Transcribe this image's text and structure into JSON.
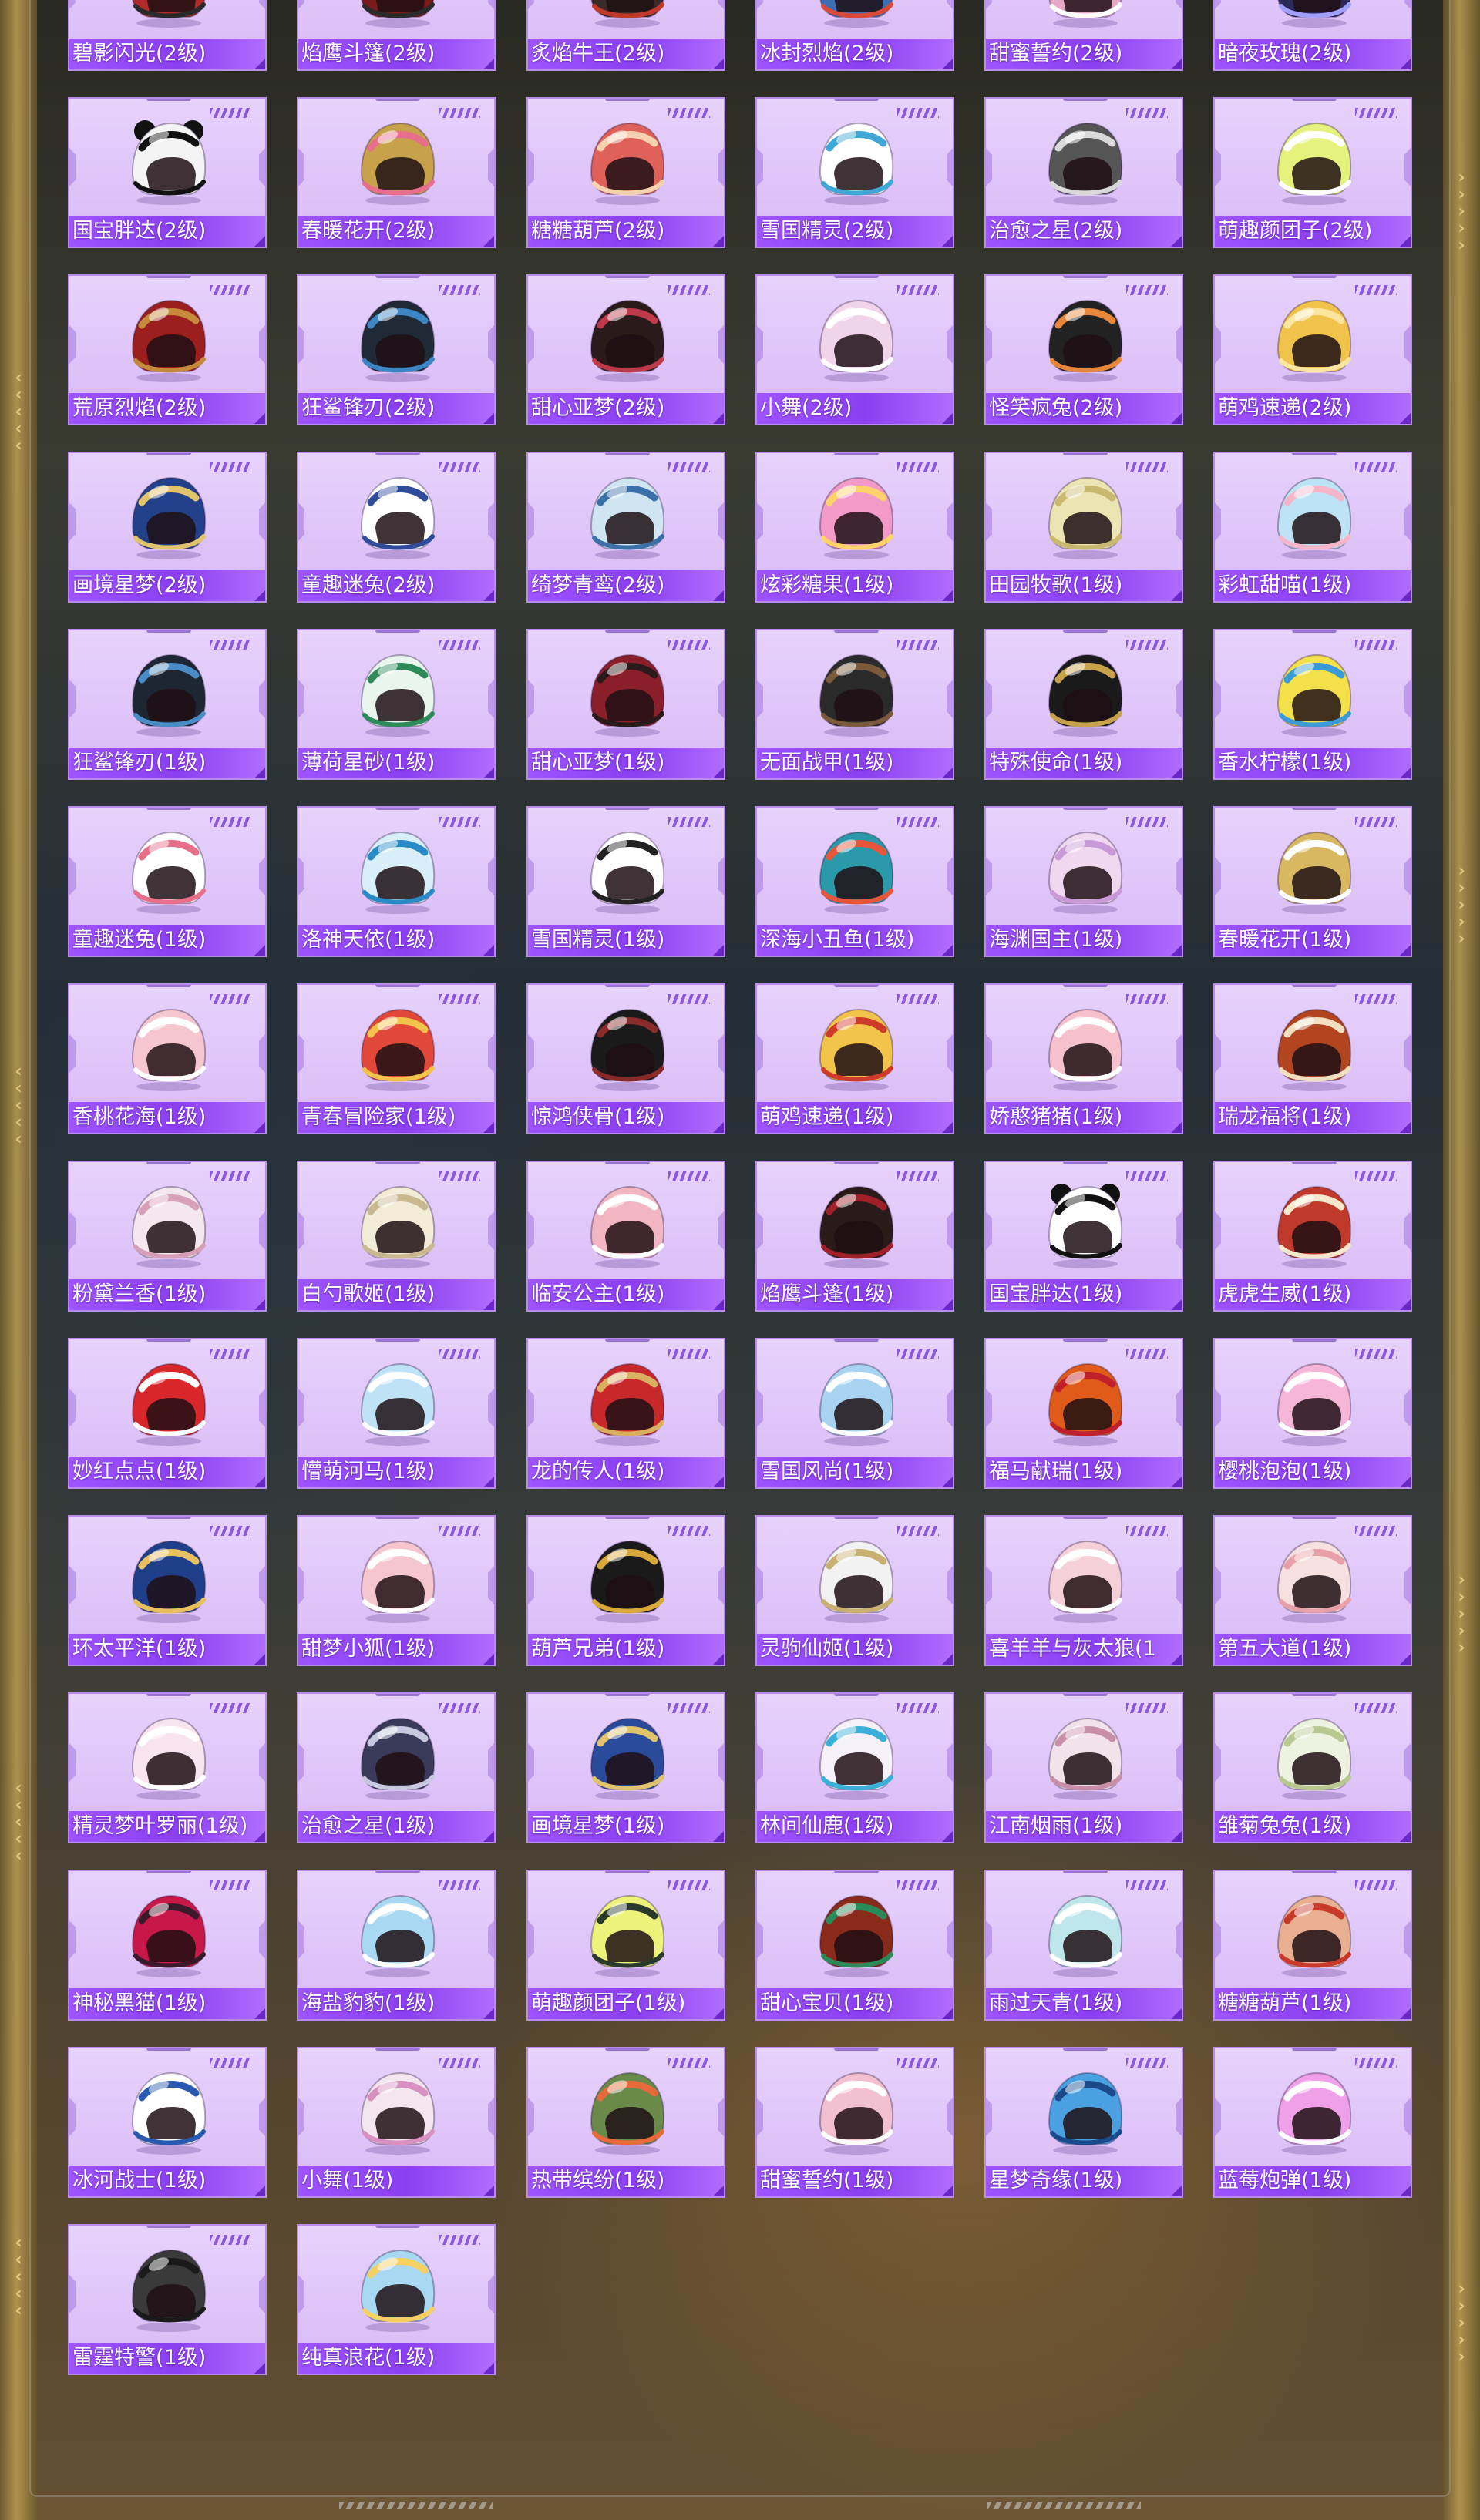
{
  "theme": {
    "card_bg": "#e1c6fa",
    "label_bg": "#9147f5",
    "accent": "#8c58e0",
    "frame_gold": "#b89a52"
  },
  "items": [
    {
      "label": "碧影闪光(2级)",
      "primary": "#b02a2a",
      "secondary": "#2a2a2a",
      "icon": "helmet-icon"
    },
    {
      "label": "焰鹰斗篷(2级)",
      "primary": "#7a1a1a",
      "secondary": "#2b2b2b",
      "icon": "helmet-icon"
    },
    {
      "label": "炙焰牛王(2级)",
      "primary": "#3a2a2a",
      "secondary": "#c0392b",
      "icon": "helmet-icon"
    },
    {
      "label": "冰封烈焰(2级)",
      "primary": "#3b6fb5",
      "secondary": "#d84a3a",
      "icon": "helmet-icon"
    },
    {
      "label": "甜蜜誓约(2级)",
      "primary": "#e7a9c6",
      "secondary": "#ffffff",
      "icon": "helmet-icon"
    },
    {
      "label": "暗夜玫瑰(2级)",
      "primary": "#2a2a5a",
      "secondary": "#a0a0ff",
      "icon": "helmet-icon"
    },
    {
      "label": "国宝胖达(2级)",
      "primary": "#f4f4f4",
      "secondary": "#111111",
      "icon": "panda-helmet-icon"
    },
    {
      "label": "春暖花开(2级)",
      "primary": "#c7a24a",
      "secondary": "#e86f8a",
      "icon": "helmet-icon"
    },
    {
      "label": "糖糖葫芦(2级)",
      "primary": "#e0615a",
      "secondary": "#f6d1b0",
      "icon": "helmet-icon"
    },
    {
      "label": "雪国精灵(2级)",
      "primary": "#ffffff",
      "secondary": "#3fa7d6",
      "icon": "helmet-icon"
    },
    {
      "label": "治愈之星(2级)",
      "primary": "#555555",
      "secondary": "#d9d9d9",
      "icon": "helmet-icon"
    },
    {
      "label": "萌趣颜团子(2级)",
      "primary": "#e5f27b",
      "secondary": "#ffffff",
      "icon": "helmet-icon"
    },
    {
      "label": "荒原烈焰(2级)",
      "primary": "#9c1f1f",
      "secondary": "#c58a3a",
      "icon": "helmet-icon"
    },
    {
      "label": "狂鲨锋刃(2级)",
      "primary": "#202a36",
      "secondary": "#3d86c6",
      "icon": "helmet-icon"
    },
    {
      "label": "甜心亚梦(2级)",
      "primary": "#2b1a1a",
      "secondary": "#c0394a",
      "icon": "helmet-icon"
    },
    {
      "label": "小舞(2级)",
      "primary": "#f1d4ea",
      "secondary": "#ffffff",
      "icon": "helmet-icon"
    },
    {
      "label": "怪笑疯兔(2级)",
      "primary": "#222222",
      "secondary": "#e8863a",
      "icon": "helmet-icon"
    },
    {
      "label": "萌鸡速递(2级)",
      "primary": "#f2c34a",
      "secondary": "#fbe6a0",
      "icon": "helmet-icon"
    },
    {
      "label": "画境星梦(2级)",
      "primary": "#23408a",
      "secondary": "#e0c36a",
      "icon": "helmet-icon"
    },
    {
      "label": "童趣迷兔(2级)",
      "primary": "#ffffff",
      "secondary": "#2f4b9a",
      "icon": "helmet-icon"
    },
    {
      "label": "绮梦青鸾(2级)",
      "primary": "#cfe6f2",
      "secondary": "#3a6fa8",
      "icon": "helmet-icon"
    },
    {
      "label": "炫彩糖果(1级)",
      "primary": "#f29ac8",
      "secondary": "#ffd36a",
      "icon": "helmet-icon"
    },
    {
      "label": "田园牧歌(1级)",
      "primary": "#ece4b2",
      "secondary": "#c9b96e",
      "icon": "helmet-icon"
    },
    {
      "label": "彩虹甜喵(1级)",
      "primary": "#bfe3f6",
      "secondary": "#f5b6c9",
      "icon": "helmet-icon"
    },
    {
      "label": "狂鲨锋刃(1级)",
      "primary": "#1d2733",
      "secondary": "#4a8cc5",
      "icon": "helmet-icon"
    },
    {
      "label": "薄荷星砂(1级)",
      "primary": "#e8f6ee",
      "secondary": "#2f8a5a",
      "icon": "helmet-icon"
    },
    {
      "label": "甜心亚梦(1级)",
      "primary": "#8a1f2a",
      "secondary": "#2a1a1a",
      "icon": "helmet-icon"
    },
    {
      "label": "无面战甲(1级)",
      "primary": "#2a2a2a",
      "secondary": "#7a5a3a",
      "icon": "helmet-icon"
    },
    {
      "label": "特殊使命(1级)",
      "primary": "#1a1a1a",
      "secondary": "#c7a24a",
      "icon": "helmet-icon"
    },
    {
      "label": "香水柠檬(1级)",
      "primary": "#f4e04a",
      "secondary": "#3a9ad6",
      "icon": "helmet-icon"
    },
    {
      "label": "童趣迷兔(1级)",
      "primary": "#ffffff",
      "secondary": "#e86f8a",
      "icon": "helmet-icon"
    },
    {
      "label": "洛神天依(1级)",
      "primary": "#d8eef8",
      "secondary": "#2a8ac6",
      "icon": "helmet-icon"
    },
    {
      "label": "雪国精灵(1级)",
      "primary": "#ffffff",
      "secondary": "#222222",
      "icon": "helmet-icon"
    },
    {
      "label": "深海小丑鱼(1级)",
      "primary": "#2a9aaa",
      "secondary": "#e8563a",
      "icon": "helmet-icon"
    },
    {
      "label": "海渊国主(1级)",
      "primary": "#f0d8f0",
      "secondary": "#c89ad8",
      "icon": "helmet-icon"
    },
    {
      "label": "春暖花开(1级)",
      "primary": "#d8b860",
      "secondary": "#ffffff",
      "icon": "helmet-icon"
    },
    {
      "label": "香桃花海(1级)",
      "primary": "#f6c6d0",
      "secondary": "#ffffff",
      "icon": "helmet-icon"
    },
    {
      "label": "青春冒险家(1级)",
      "primary": "#e2483a",
      "secondary": "#f2c34a",
      "icon": "helmet-icon"
    },
    {
      "label": "惊鸿侠骨(1级)",
      "primary": "#1a1a1a",
      "secondary": "#8a2a2a",
      "icon": "helmet-icon"
    },
    {
      "label": "萌鸡速递(1级)",
      "primary": "#f2c44a",
      "secondary": "#d03a2a",
      "icon": "helmet-icon"
    },
    {
      "label": "娇憨猪猪(1级)",
      "primary": "#f6c0cc",
      "secondary": "#ffffff",
      "icon": "helmet-icon"
    },
    {
      "label": "瑞龙福将(1级)",
      "primary": "#b2441f",
      "secondary": "#f0e0c0",
      "icon": "helmet-icon"
    },
    {
      "label": "粉黛兰香(1级)",
      "primary": "#f4e8ee",
      "secondary": "#d8a0b8",
      "icon": "helmet-icon"
    },
    {
      "label": "白勺歌姬(1级)",
      "primary": "#f2ebd6",
      "secondary": "#c9b890",
      "icon": "helmet-icon"
    },
    {
      "label": "临安公主(1级)",
      "primary": "#f2b6c2",
      "secondary": "#ffffff",
      "icon": "helmet-icon"
    },
    {
      "label": "焰鹰斗篷(1级)",
      "primary": "#2a1a1a",
      "secondary": "#a0202a",
      "icon": "helmet-icon"
    },
    {
      "label": "国宝胖达(1级)",
      "primary": "#ffffff",
      "secondary": "#111111",
      "icon": "panda-helmet-icon"
    },
    {
      "label": "虎虎生威(1级)",
      "primary": "#c0392b",
      "secondary": "#f6e6cc",
      "icon": "helmet-icon"
    },
    {
      "label": "妙红点点(1级)",
      "primary": "#d8262a",
      "secondary": "#ffffff",
      "icon": "helmet-icon"
    },
    {
      "label": "懵萌河马(1级)",
      "primary": "#bfe2f6",
      "secondary": "#ffffff",
      "icon": "helmet-icon"
    },
    {
      "label": "龙的传人(1级)",
      "primary": "#c8282a",
      "secondary": "#d8b060",
      "icon": "helmet-icon"
    },
    {
      "label": "雪国风尚(1级)",
      "primary": "#a8d4f2",
      "secondary": "#ffffff",
      "icon": "helmet-icon"
    },
    {
      "label": "福马献瑞(1级)",
      "primary": "#e05a1a",
      "secondary": "#c0202a",
      "icon": "helmet-icon"
    },
    {
      "label": "樱桃泡泡(1级)",
      "primary": "#f6b6d8",
      "secondary": "#ffffff",
      "icon": "helmet-icon"
    },
    {
      "label": "环太平洋(1级)",
      "primary": "#1f3f8a",
      "secondary": "#e8c060",
      "icon": "helmet-icon"
    },
    {
      "label": "甜梦小狐(1级)",
      "primary": "#f6c6d0",
      "secondary": "#ffffff",
      "icon": "helmet-icon"
    },
    {
      "label": "葫芦兄弟(1级)",
      "primary": "#1a1a1a",
      "secondary": "#d8a83a",
      "icon": "helmet-icon"
    },
    {
      "label": "灵驹仙姬(1级)",
      "primary": "#f2f2f2",
      "secondary": "#c8b070",
      "icon": "helmet-icon"
    },
    {
      "label": "喜羊羊与灰太狼(1",
      "primary": "#f6d0d8",
      "secondary": "#ffffff",
      "icon": "helmet-icon"
    },
    {
      "label": "第五大道(1级)",
      "primary": "#f6e0e0",
      "secondary": "#e8a0a8",
      "icon": "helmet-icon"
    },
    {
      "label": "精灵梦叶罗丽(1级)",
      "primary": "#f8e4ee",
      "secondary": "#ffffff",
      "icon": "helmet-icon"
    },
    {
      "label": "治愈之星(1级)",
      "primary": "#3a3a5a",
      "secondary": "#c8c8e0",
      "icon": "helmet-icon"
    },
    {
      "label": "画境星梦(1级)",
      "primary": "#2a4a9a",
      "secondary": "#e0c36a",
      "icon": "helmet-icon"
    },
    {
      "label": "林间仙鹿(1级)",
      "primary": "#f6f0f8",
      "secondary": "#3ab0d8",
      "icon": "helmet-icon"
    },
    {
      "label": "江南烟雨(1级)",
      "primary": "#f2e2ea",
      "secondary": "#c890a8",
      "icon": "helmet-icon"
    },
    {
      "label": "雏菊兔兔(1级)",
      "primary": "#eef2e0",
      "secondary": "#b8c890",
      "icon": "helmet-icon"
    },
    {
      "label": "神秘黑猫(1级)",
      "primary": "#c8184a",
      "secondary": "#3a1a2a",
      "icon": "helmet-icon"
    },
    {
      "label": "海盐豹豹(1级)",
      "primary": "#a8d8f2",
      "secondary": "#ffffff",
      "icon": "helmet-icon"
    },
    {
      "label": "萌趣颜团子(1级)",
      "primary": "#ecf27a",
      "secondary": "#2a3a2a",
      "icon": "helmet-icon"
    },
    {
      "label": "甜心宝贝(1级)",
      "primary": "#8a2a1a",
      "secondary": "#2a8a5a",
      "icon": "helmet-icon"
    },
    {
      "label": "雨过天青(1级)",
      "primary": "#bfe6ea",
      "secondary": "#ffffff",
      "icon": "helmet-icon"
    },
    {
      "label": "糖糖葫芦(1级)",
      "primary": "#e8b090",
      "secondary": "#c83a2a",
      "icon": "helmet-icon"
    },
    {
      "label": "冰河战士(1级)",
      "primary": "#ffffff",
      "secondary": "#2a5ab0",
      "icon": "helmet-icon"
    },
    {
      "label": "小舞(1级)",
      "primary": "#f4e6ee",
      "secondary": "#d890c0",
      "icon": "helmet-icon"
    },
    {
      "label": "热带缤纷(1级)",
      "primary": "#6a8a4a",
      "secondary": "#e86a3a",
      "icon": "helmet-icon"
    },
    {
      "label": "甜蜜誓约(1级)",
      "primary": "#f2c0d0",
      "secondary": "#ffffff",
      "icon": "helmet-icon"
    },
    {
      "label": "星梦奇缘(1级)",
      "primary": "#4aa0e0",
      "secondary": "#1a4a8a",
      "icon": "helmet-icon"
    },
    {
      "label": "蓝莓炮弹(1级)",
      "primary": "#f0a0e8",
      "secondary": "#ffffff",
      "icon": "helmet-icon"
    },
    {
      "label": "雷霆特警(1级)",
      "primary": "#3a3a3a",
      "secondary": "#1a1a1a",
      "icon": "helmet-icon"
    },
    {
      "label": "纯真浪花(1级)",
      "primary": "#a8d8f2",
      "secondary": "#f6d060",
      "icon": "helmet-icon"
    }
  ]
}
